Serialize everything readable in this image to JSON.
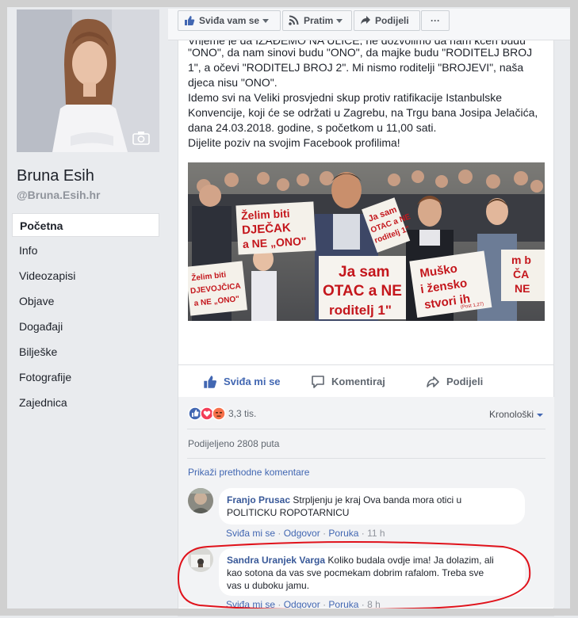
{
  "profile": {
    "name": "Bruna Esih",
    "handle": "@Bruna.Esih.hr",
    "nav": [
      "Početna",
      "Info",
      "Videozapisi",
      "Objave",
      "Događaji",
      "Bilješke",
      "Fotografije",
      "Zajednica"
    ]
  },
  "toolbar": {
    "like_label": "Sviđa vam se",
    "follow_label": "Pratim",
    "share_label": "Podijeli",
    "more_label": "···"
  },
  "post": {
    "lines": [
      "Vrijeme je da IZAĐEMO NA ULICE, ne dozvolimo da nam kćeri budu",
      "\"ONO\", da nam sinovi budu \"ONO\", da majke budu \"RODITELJ BROJ",
      "1\", a očevi \"RODITELJ BROJ 2\". Mi nismo roditelji \"BROJEVI\", naša",
      "djeca nisu \"ONO\".",
      "Idemo svi na Veliki prosvjedni skup protiv ratifikacije Istanbulske",
      "Konvencije, koji će se održati u Zagrebu, na Trgu bana Josipa Jelačića,",
      "dana 24.03.2018. godine, s početkom u 11,00 sati.",
      "Dijelite poziv na svojim Facebook profilima!"
    ],
    "photo_signs": {
      "sign1": [
        "Želim biti",
        "DJEČAK",
        "a NE „ONO\""
      ],
      "sign2": [
        "Ja sam",
        "OTAC a NE",
        "roditelj 1\""
      ],
      "sign3": [
        "Muško",
        "i žensko",
        "stvori ih"
      ],
      "sign3_ref": "(Post 1,27)",
      "sign4": [
        "Želim biti",
        "DJEVOJČICA",
        "a NE „ONO\""
      ],
      "sign5": [
        "Ja sam",
        "OTAC a NE",
        "roditelj 1\""
      ],
      "sign6": [
        "m b",
        "ČA",
        "NE"
      ]
    }
  },
  "actions": {
    "like": "Sviđa mi se",
    "comment": "Komentiraj",
    "share": "Podijeli"
  },
  "reactions": {
    "count": "3,3 tis.",
    "sort_label": "Kronološki",
    "shares": "Podijeljeno 2808 puta",
    "prev_comments": "Prikaži prethodne komentare",
    "colors": {
      "like": "#4267b2",
      "love": "#f33e58",
      "angry": "#f7714b",
      "highlight": "#e0121b"
    }
  },
  "comments": [
    {
      "author": "Franjo Prusac",
      "text_line1": "Strpljenju je kraj Ova banda mora otici u",
      "text_line2": "POLITICKU ROPOTARNICU",
      "like": "Sviđa mi se",
      "reply": "Odgovor",
      "message": "Poruka",
      "time": "11 h"
    },
    {
      "author": "Sandra Uranjek Varga",
      "text_line1": "Koliko budala ovdje ima! Ja dolazim, ali",
      "text_line2": "kao sotona da vas sve pocmekam dobrim rafalom. Treba sve",
      "text_line3": "vas u duboku jamu.",
      "like": "Sviđa mi se",
      "reply": "Odgovor",
      "message": "Poruka",
      "time": "8 h"
    }
  ]
}
